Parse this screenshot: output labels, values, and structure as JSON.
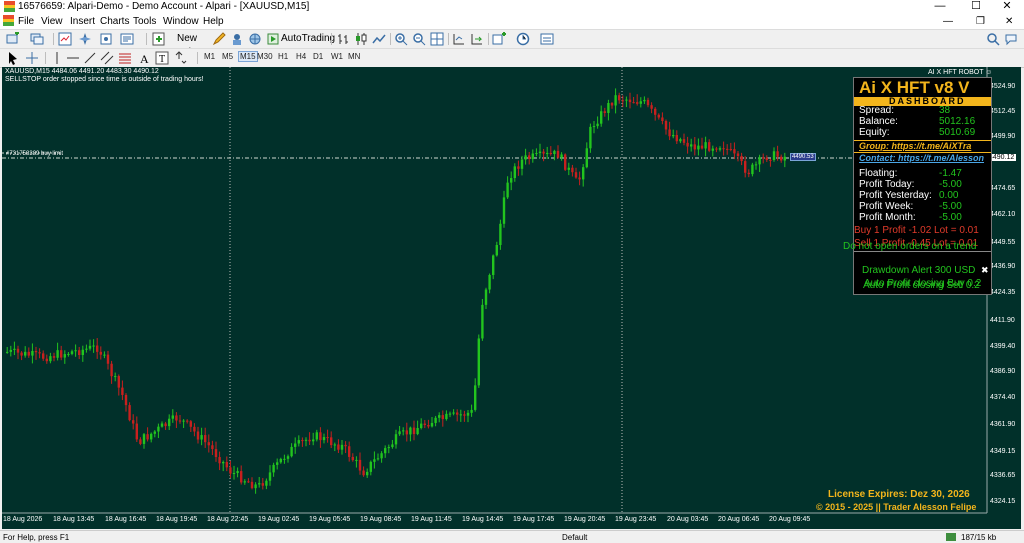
{
  "window": {
    "title": "16576659: Alpari-Demo - Demo Account - Alpari - [XAUUSD,M15]"
  },
  "menu": {
    "items": [
      "File",
      "View",
      "Insert",
      "Charts",
      "Tools",
      "Window",
      "Help"
    ]
  },
  "toolbar": {
    "new_order": "New Order",
    "autotrading": "AutoTrading",
    "periods": [
      "M1",
      "M5",
      "M15",
      "M30",
      "H1",
      "H4",
      "D1",
      "W1",
      "MN"
    ],
    "active_period": "M15"
  },
  "chart": {
    "header_line1": "XAUUSD,M15  4484.06 4491.20 4483.30 4490.12",
    "header_line2": "SELLSTOP order stopped since time is outside of trading hours!",
    "order_label": "#731758389 buy limit",
    "bid_price": "4490.12",
    "price_marker": "4490.53",
    "price_ticks": [
      "4524.90",
      "4512.45",
      "4499.90",
      "4487.35",
      "4474.65",
      "4462.10",
      "4449.55",
      "4436.90",
      "4424.35",
      "4411.90",
      "4399.40",
      "4386.90",
      "4374.40",
      "4361.90",
      "4349.15",
      "4336.65",
      "4324.15"
    ],
    "time_ticks": [
      "18 Aug 2026",
      "18 Aug 13:45",
      "18 Aug 16:45",
      "18 Aug 19:45",
      "18 Aug 22:45",
      "19 Aug 02:45",
      "19 Aug 05:45",
      "19 Aug 08:45",
      "19 Aug 11:45",
      "19 Aug 14:45",
      "19 Aug 17:45",
      "19 Aug 20:45",
      "19 Aug 23:45",
      "20 Aug 03:45",
      "20 Aug 06:45",
      "20 Aug 09:45"
    ]
  },
  "robot": {
    "title": "AI X HFT ROBOT ☺",
    "name": "Ai X HFT v8 V",
    "subtitle": "DASHBOARD",
    "spread_label": "Spread:",
    "spread": "38",
    "balance_label": "Balance:",
    "balance": "5012.16",
    "equity_label": "Equity:",
    "equity": "5010.69",
    "group": "Group: https://t.me/AiXTra",
    "contact": "Contact: https://t.me/Alesson",
    "floating_label": "Floating:",
    "floating": "-1.47",
    "today_label": "Profit Today:",
    "today": "-5.00",
    "yesterday_label": "Profit Yesterday:",
    "yesterday": "0.00",
    "week_label": "Profit Week:",
    "week": "-5.00",
    "month_label": "Profit Month:",
    "month": "-5.00",
    "buy_line": "Buy 1 Profit -1.02 Lot = 0.01",
    "sell_line": "Sell 1 Profit -0.45 Lot = 0.01",
    "trend_note": "Do not open orders on a trend",
    "drawdown": "Drawdown Alert 300 USD",
    "auto_buy": "Auto Profit closing Buy 0.2",
    "auto_sell": "Auto Profit closing Sell 0.2",
    "license": "License Expires: Dez 30, 2026",
    "copyright": "© 2015 - 2025 || Trader Alesson Felipe"
  },
  "status": {
    "help": "For Help, press F1",
    "profile": "Default",
    "traffic": "187/15 kb"
  },
  "colors": {
    "bg": "#01302a",
    "bull": "#22c41e",
    "bear": "#c8201e",
    "gold": "#f3b51c"
  }
}
